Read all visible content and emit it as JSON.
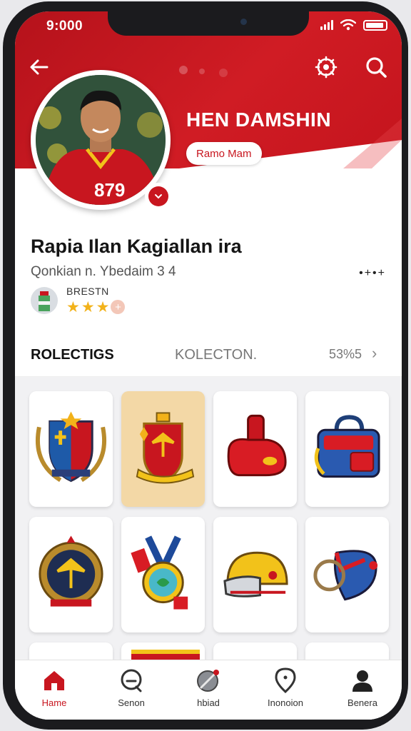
{
  "status_bar": {
    "time": "9:000"
  },
  "header": {
    "brand": "HEN DAMSHIN",
    "role_badge": "Ramo Mam",
    "jersey_number": "879"
  },
  "profile": {
    "full_name": "Rapia Ilan Kagiallan ira",
    "subtitle": "Qonkian n. Ybedaim 3 4",
    "more_label": "•+•+",
    "club_name": "BRESTN",
    "rating": 3
  },
  "tabs": {
    "active": "ROLECTIGS",
    "other": "KOLECTON.",
    "count": "53%5",
    "chevron": "›"
  },
  "collection_items": [
    {
      "name": "shield-crest",
      "selected": false
    },
    {
      "name": "eagle-badge",
      "selected": true
    },
    {
      "name": "red-boot",
      "selected": false
    },
    {
      "name": "sports-bag",
      "selected": false
    },
    {
      "name": "wreath-emblem",
      "selected": false
    },
    {
      "name": "medal",
      "selected": false
    },
    {
      "name": "helmet",
      "selected": false
    },
    {
      "name": "horn-shield",
      "selected": false
    }
  ],
  "bottom_nav": [
    {
      "label": "Hame",
      "icon": "home-icon",
      "active": true
    },
    {
      "label": "Senon",
      "icon": "search-face-icon",
      "active": false
    },
    {
      "label": "hbiad",
      "icon": "ball-icon",
      "active": false
    },
    {
      "label": "Inonoion",
      "icon": "location-icon",
      "active": false
    },
    {
      "label": "Benera",
      "icon": "user-icon",
      "active": false
    }
  ],
  "colors": {
    "brand_red": "#c8161f",
    "star": "#f2b21a"
  }
}
